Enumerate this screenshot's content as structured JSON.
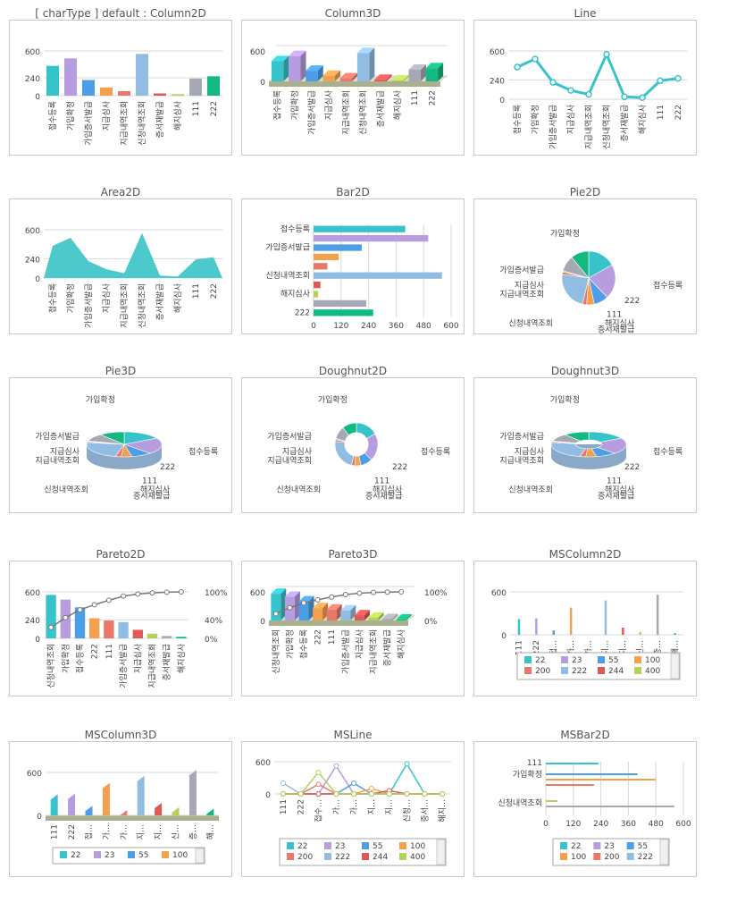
{
  "palette": [
    "#36c3c9",
    "#b79ce0",
    "#4c9ee6",
    "#f3a04f",
    "#e8786a",
    "#92bde3",
    "#e05858",
    "#b4d25a",
    "#a6a8b5",
    "#13b981"
  ],
  "categories": [
    "접수등록",
    "가입확정",
    "가입증서발급",
    "지급심사",
    "지급내역조회",
    "신청내역조회",
    "증서재발급",
    "해지심사",
    "111",
    "222"
  ],
  "values": [
    400,
    500,
    210,
    110,
    60,
    560,
    30,
    20,
    230,
    260
  ],
  "ms_series": [
    "22",
    "23",
    "55",
    "100",
    "200",
    "222",
    "244",
    "400"
  ],
  "pareto_categories": [
    "신청내역조회",
    "가입확정",
    "접수등록",
    "222",
    "111",
    "가입증서발급",
    "지급심사",
    "지급내역조회",
    "증서재발급",
    "해지심사"
  ],
  "pareto_values": [
    560,
    500,
    400,
    260,
    230,
    210,
    110,
    60,
    30,
    20
  ],
  "pareto_pct_ticks": [
    "100%",
    "40%",
    "0%"
  ],
  "charts": [
    {
      "title": "[ charType ] default : Column2D",
      "type": "column2d",
      "ylim": [
        0,
        600
      ],
      "yticks": [
        "600",
        "240",
        "0"
      ]
    },
    {
      "title": "Column3D",
      "type": "column3d",
      "ylim": [
        0,
        600
      ],
      "yticks": [
        "600",
        "0"
      ]
    },
    {
      "title": "Line",
      "type": "line",
      "ylim": [
        0,
        600
      ],
      "yticks": [
        "600",
        "240",
        "0"
      ]
    },
    {
      "title": "Area2D",
      "type": "area",
      "ylim": [
        0,
        600
      ],
      "yticks": [
        "600",
        "240",
        "0"
      ]
    },
    {
      "title": "Bar2D",
      "type": "bar",
      "xlim": [
        0,
        600
      ],
      "xticks": [
        "0",
        "120",
        "240",
        "360",
        "480",
        "600"
      ],
      "shown_labels": [
        "접수등록",
        "가입증서발급",
        "신청내역조회",
        "해지심사",
        "222"
      ]
    },
    {
      "title": "Pie2D",
      "type": "pie"
    },
    {
      "title": "Pie3D",
      "type": "pie3d"
    },
    {
      "title": "Doughnut2D",
      "type": "doughnut"
    },
    {
      "title": "Doughnut3D",
      "type": "doughnut3d"
    },
    {
      "title": "Pareto2D",
      "type": "pareto",
      "ylim": [
        0,
        600
      ],
      "yticks": [
        "600",
        "240",
        "0"
      ],
      "right_ticks": [
        "100%",
        "40%",
        "0%"
      ]
    },
    {
      "title": "Pareto3D",
      "type": "pareto3d",
      "ylim": [
        0,
        600
      ],
      "yticks": [
        "600",
        "0"
      ],
      "right_ticks": [
        "100%",
        "0%"
      ]
    },
    {
      "title": "MSColumn2D",
      "type": "mscolumn",
      "ylim": [
        0,
        600
      ],
      "yticks": [
        "600",
        "0"
      ],
      "categories": [
        "111",
        "222",
        "접…",
        "가…",
        "가…",
        "지…",
        "지…",
        "신…",
        "증…",
        "해…"
      ],
      "legend": [
        "22",
        "23",
        "55",
        "100",
        "200",
        "222",
        "244",
        "400"
      ]
    },
    {
      "title": "MSColumn3D",
      "type": "mscolumn3d",
      "ylim": [
        0,
        600
      ],
      "yticks": [
        "600",
        "0"
      ],
      "categories": [
        "111",
        "222",
        "접…",
        "가…",
        "가…",
        "지…",
        "지…",
        "신…",
        "증…",
        "해…"
      ],
      "legend": [
        "22",
        "23",
        "55",
        "100"
      ]
    },
    {
      "title": "MSLine",
      "type": "msline",
      "ylim": [
        0,
        600
      ],
      "yticks": [
        "600",
        "0"
      ],
      "categories": [
        "111",
        "222",
        "접수…",
        "가…",
        "가…",
        "지…",
        "지…",
        "신청…",
        "증서…",
        "해지…"
      ],
      "legend": [
        "22",
        "23",
        "55",
        "100",
        "200",
        "222",
        "244",
        "400"
      ]
    },
    {
      "title": "MSBar2D",
      "type": "msbar",
      "xlim": [
        0,
        600
      ],
      "xticks": [
        "0",
        "120",
        "240",
        "360",
        "480",
        "600"
      ],
      "shown_labels": [
        "111",
        "가입확정",
        "신청내역조회"
      ],
      "legend": [
        "22",
        "23",
        "55",
        "100",
        "200",
        "222"
      ]
    }
  ],
  "chart_data": [
    {
      "type": "bar",
      "title": "[ charType ] default : Column2D",
      "categories": [
        "접수등록",
        "가입확정",
        "가입증서발급",
        "지급심사",
        "지급내역조회",
        "신청내역조회",
        "증서재발급",
        "해지심사",
        "111",
        "222"
      ],
      "values": [
        400,
        500,
        210,
        110,
        60,
        560,
        30,
        20,
        230,
        260
      ],
      "ylim": [
        0,
        600
      ]
    },
    {
      "type": "bar",
      "title": "Column3D",
      "categories": [
        "접수등록",
        "가입확정",
        "가입증서발급",
        "지급심사",
        "지급내역조회",
        "신청내역조회",
        "증서재발급",
        "해지심사",
        "111",
        "222"
      ],
      "values": [
        400,
        500,
        210,
        110,
        60,
        560,
        30,
        20,
        230,
        260
      ],
      "ylim": [
        0,
        600
      ]
    },
    {
      "type": "line",
      "title": "Line",
      "categories": [
        "접수등록",
        "가입확정",
        "가입증서발급",
        "지급심사",
        "지급내역조회",
        "신청내역조회",
        "증서재발급",
        "해지심사",
        "111",
        "222"
      ],
      "values": [
        400,
        500,
        210,
        110,
        60,
        560,
        30,
        20,
        230,
        260
      ],
      "ylim": [
        0,
        600
      ]
    },
    {
      "type": "area",
      "title": "Area2D",
      "categories": [
        "접수등록",
        "가입확정",
        "가입증서발급",
        "지급심사",
        "지급내역조회",
        "신청내역조회",
        "증서재발급",
        "해지심사",
        "111",
        "222"
      ],
      "values": [
        400,
        500,
        210,
        110,
        60,
        560,
        30,
        20,
        230,
        260
      ],
      "ylim": [
        0,
        600
      ]
    },
    {
      "type": "bar",
      "title": "Bar2D",
      "categories": [
        "접수등록",
        "가입확정",
        "가입증서발급",
        "지급심사",
        "지급내역조회",
        "신청내역조회",
        "증서재발급",
        "해지심사",
        "111",
        "222"
      ],
      "values": [
        400,
        500,
        210,
        110,
        60,
        560,
        30,
        20,
        230,
        260
      ],
      "xlim": [
        0,
        600
      ]
    },
    {
      "type": "pie",
      "title": "Pie2D",
      "categories": [
        "접수등록",
        "가입확정",
        "가입증서발급",
        "지급심사",
        "지급내역조회",
        "신청내역조회",
        "증서재발급",
        "해지심사",
        "111",
        "222"
      ],
      "values": [
        400,
        500,
        210,
        110,
        60,
        560,
        30,
        20,
        230,
        260
      ]
    },
    {
      "type": "pie",
      "title": "Pie3D",
      "categories": [
        "접수등록",
        "가입확정",
        "가입증서발급",
        "지급심사",
        "지급내역조회",
        "신청내역조회",
        "증서재발급",
        "해지심사",
        "111",
        "222"
      ],
      "values": [
        400,
        500,
        210,
        110,
        60,
        560,
        30,
        20,
        230,
        260
      ]
    },
    {
      "type": "pie",
      "title": "Doughnut2D",
      "categories": [
        "접수등록",
        "가입확정",
        "가입증서발급",
        "지급심사",
        "지급내역조회",
        "신청내역조회",
        "증서재발급",
        "해지심사",
        "111",
        "222"
      ],
      "values": [
        400,
        500,
        210,
        110,
        60,
        560,
        30,
        20,
        230,
        260
      ]
    },
    {
      "type": "pie",
      "title": "Doughnut3D",
      "categories": [
        "접수등록",
        "가입확정",
        "가입증서발급",
        "지급심사",
        "지급내역조회",
        "신청내역조회",
        "증서재발급",
        "해지심사",
        "111",
        "222"
      ],
      "values": [
        400,
        500,
        210,
        110,
        60,
        560,
        30,
        20,
        230,
        260
      ]
    },
    {
      "type": "bar",
      "title": "Pareto2D",
      "categories": [
        "신청내역조회",
        "가입확정",
        "접수등록",
        "222",
        "111",
        "가입증서발급",
        "지급심사",
        "지급내역조회",
        "증서재발급",
        "해지심사"
      ],
      "values": [
        560,
        500,
        400,
        260,
        230,
        210,
        110,
        60,
        30,
        20
      ],
      "ylim": [
        0,
        600
      ]
    },
    {
      "type": "bar",
      "title": "Pareto3D",
      "categories": [
        "신청내역조회",
        "가입확정",
        "접수등록",
        "222",
        "111",
        "가입증서발급",
        "지급심사",
        "지급내역조회",
        "증서재발급",
        "해지심사"
      ],
      "values": [
        560,
        500,
        400,
        260,
        230,
        210,
        110,
        60,
        30,
        20
      ],
      "ylim": [
        0,
        600
      ]
    },
    {
      "type": "bar",
      "title": "MSColumn2D",
      "series": [
        "22",
        "23",
        "55",
        "100",
        "200",
        "222",
        "244",
        "400"
      ],
      "ylim": [
        0,
        600
      ]
    },
    {
      "type": "bar",
      "title": "MSColumn3D",
      "series": [
        "22",
        "23",
        "55",
        "100"
      ],
      "ylim": [
        0,
        600
      ]
    },
    {
      "type": "line",
      "title": "MSLine",
      "series": [
        "22",
        "23",
        "55",
        "100",
        "200",
        "222",
        "244",
        "400"
      ],
      "ylim": [
        0,
        600
      ]
    },
    {
      "type": "bar",
      "title": "MSBar2D",
      "series": [
        "22",
        "23",
        "55",
        "100",
        "200",
        "222"
      ],
      "xlim": [
        0,
        600
      ]
    }
  ]
}
